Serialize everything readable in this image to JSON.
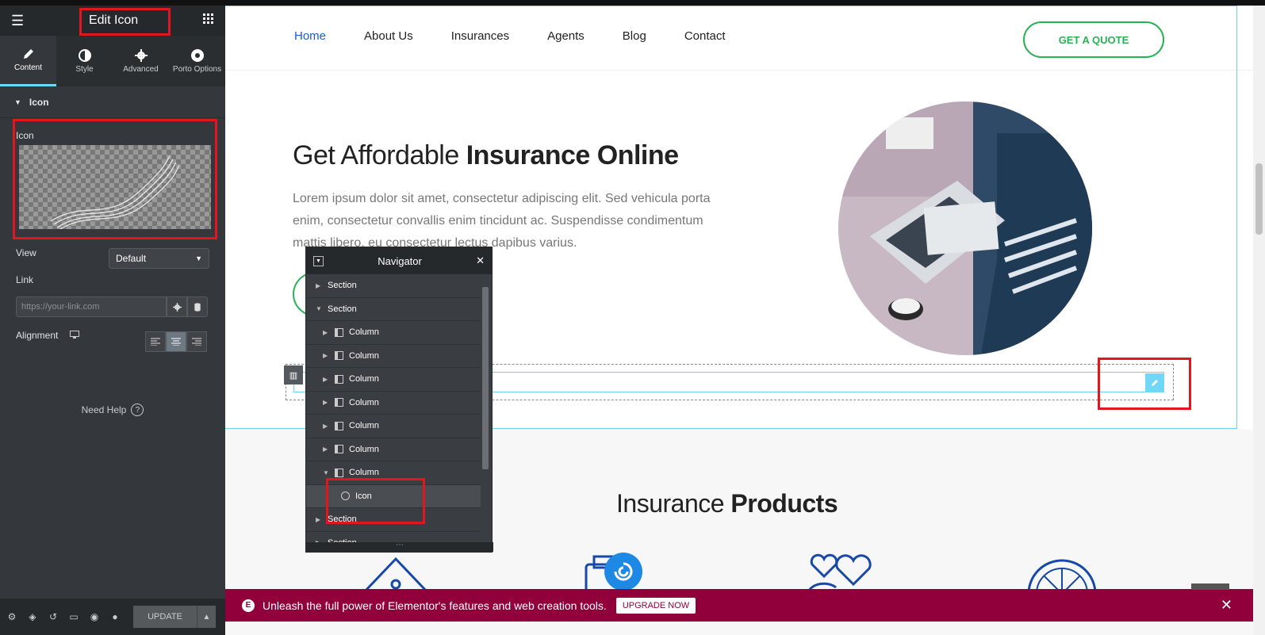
{
  "panel": {
    "title": "Edit Icon",
    "tabs": [
      {
        "label": "Content",
        "icon": "pencil-icon"
      },
      {
        "label": "Style",
        "icon": "contrast-icon"
      },
      {
        "label": "Advanced",
        "icon": "gear-icon"
      },
      {
        "label": "Porto Options",
        "icon": "porto-icon"
      }
    ],
    "section_title": "Icon",
    "icon_label": "Icon",
    "view_label": "View",
    "view_value": "Default",
    "link_label": "Link",
    "link_placeholder": "https://your-link.com",
    "alignment_label": "Alignment",
    "need_help": "Need Help",
    "update_label": "UPDATE"
  },
  "site": {
    "nav": [
      "Home",
      "About Us",
      "Insurances",
      "Agents",
      "Blog",
      "Contact"
    ],
    "quote_button": "GET A QUOTE",
    "hero_title_light": "Get Affordable ",
    "hero_title_bold": "Insurance Online",
    "hero_text": "Lorem ipsum dolor sit amet, consectetur adipiscing elit. Sed vehicula porta enim, consectetur convallis enim tincidunt ac. Suspendisse condimentum mattis libero, eu consectetur lectus dapibus varius.",
    "products_title_light": "Insurance ",
    "products_title_bold": "Products"
  },
  "navigator": {
    "title": "Navigator",
    "items": [
      {
        "label": "Section",
        "level": 0,
        "expanded": false
      },
      {
        "label": "Section",
        "level": 0,
        "expanded": true
      },
      {
        "label": "Column",
        "level": 1,
        "expanded": false
      },
      {
        "label": "Column",
        "level": 1,
        "expanded": false
      },
      {
        "label": "Column",
        "level": 1,
        "expanded": false
      },
      {
        "label": "Column",
        "level": 1,
        "expanded": false
      },
      {
        "label": "Column",
        "level": 1,
        "expanded": false
      },
      {
        "label": "Column",
        "level": 1,
        "expanded": false
      },
      {
        "label": "Column",
        "level": 1,
        "expanded": true
      },
      {
        "label": "Icon",
        "level": 2,
        "expanded": false
      },
      {
        "label": "Section",
        "level": 0,
        "expanded": false
      },
      {
        "label": "Section",
        "level": 0,
        "expanded": false
      }
    ]
  },
  "banner": {
    "text": "Unleash the full power of Elementor's features and web creation tools.",
    "button": "UPGRADE NOW"
  },
  "colors": {
    "accent": "#71d7f7",
    "brand_green": "#27b352",
    "nav_active": "#1a5fc9",
    "banner": "#92003b",
    "highlight": "#e2161f"
  }
}
